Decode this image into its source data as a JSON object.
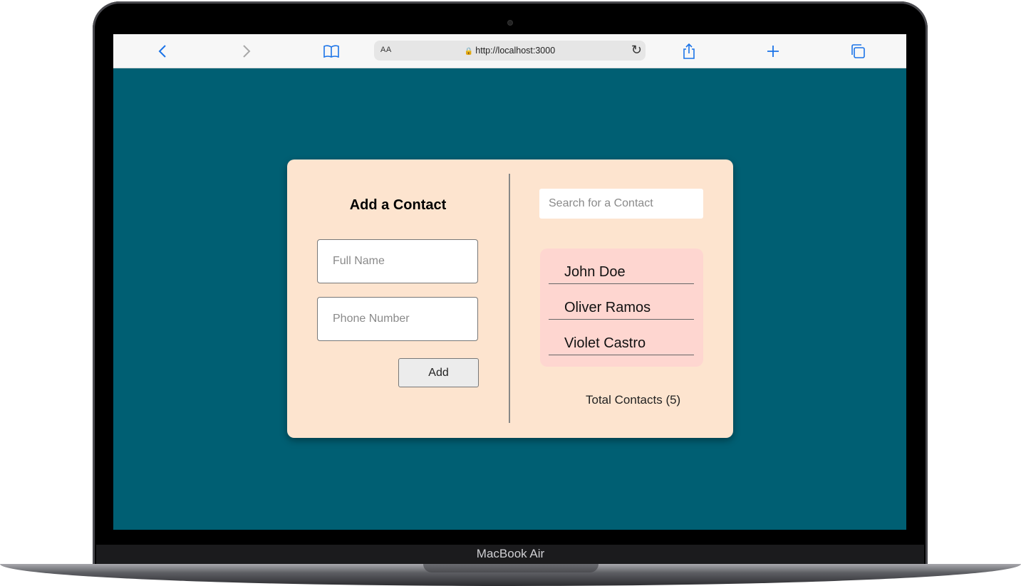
{
  "device": {
    "brand": "MacBook Air"
  },
  "browser": {
    "text_size_label": "AA",
    "url": "http://localhost:3000",
    "icons": {
      "back": "chevron-left-icon",
      "forward": "chevron-right-icon",
      "bookmarks": "book-icon",
      "reload": "reload-icon",
      "share": "share-icon",
      "new_tab": "plus-icon",
      "tabs": "tabs-icon"
    },
    "accent_color": "#1a73e8"
  },
  "app": {
    "background_color": "#005f73",
    "card_color": "#fde4cf",
    "form": {
      "title": "Add a Contact",
      "full_name_placeholder": "Full Name",
      "phone_placeholder": "Phone Number",
      "add_label": "Add"
    },
    "search": {
      "placeholder": "Search for a Contact"
    },
    "contacts": [
      "John Doe",
      "Oliver Ramos",
      "Violet Castro"
    ],
    "total_label": "Total Contacts (5)"
  }
}
